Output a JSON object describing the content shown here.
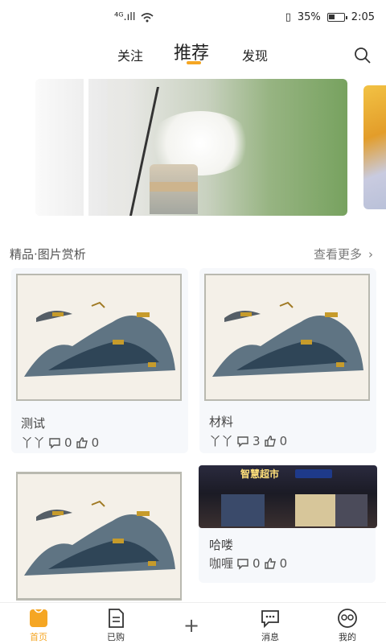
{
  "status_bar": {
    "signal": "⁴ᴳ.ıll",
    "battery": "35%",
    "time": "2:05"
  },
  "top_tabs": [
    {
      "label": "关注"
    },
    {
      "label": "推荐"
    },
    {
      "label": "发现"
    }
  ],
  "section": {
    "title": "精品·图片赏析",
    "more": "查看更多"
  },
  "cards": [
    {
      "title": "测试",
      "author": "丫丫",
      "comments": "0",
      "likes": "0"
    },
    {
      "title": "材料",
      "author": "丫丫",
      "comments": "3",
      "likes": "0"
    },
    {
      "title": "",
      "author": "",
      "comments": "",
      "likes": ""
    },
    {
      "title": "哈喽",
      "author": "咖喱",
      "comments": "0",
      "likes": "0"
    }
  ],
  "store_sign": "智慧超市",
  "bottom_nav": [
    {
      "label": "首页"
    },
    {
      "label": "已购"
    },
    {
      "label": "+"
    },
    {
      "label": "消息"
    },
    {
      "label": "我的"
    }
  ],
  "colors": {
    "accent": "#f5a623"
  }
}
